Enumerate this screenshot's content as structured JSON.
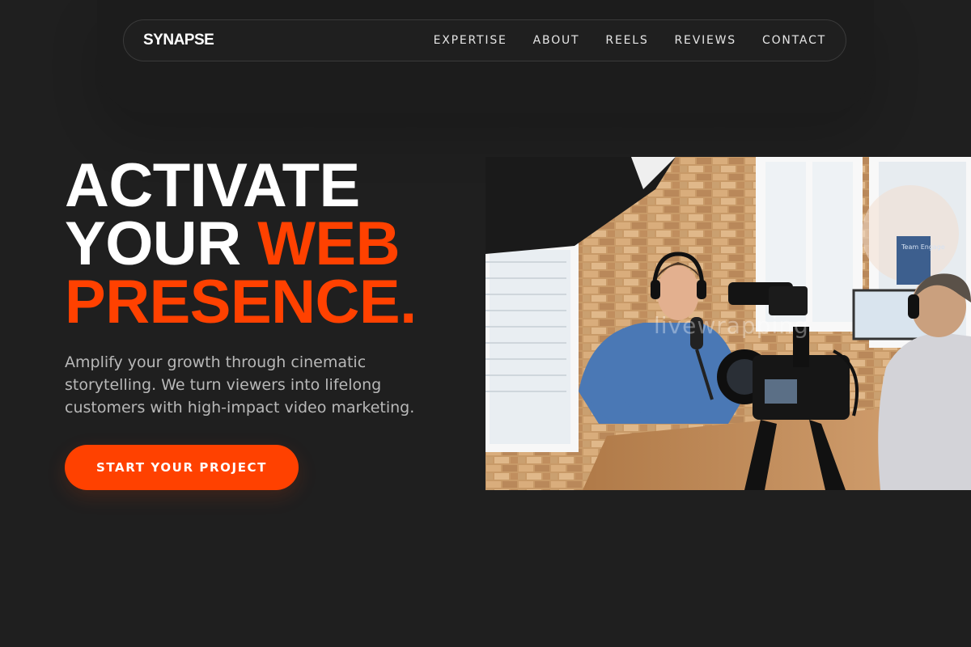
{
  "nav": {
    "logo": "SYNAPSE",
    "links": [
      "EXPERTISE",
      "ABOUT",
      "REELS",
      "REVIEWS",
      "CONTACT"
    ]
  },
  "hero": {
    "headline_line1": "ACTIVATE",
    "headline_line2_white": "YOUR",
    "headline_line2_accent": "WEB",
    "headline_line3_accent": "PRESENCE.",
    "subtitle": "Amplify your growth through cinematic storytelling. We turn viewers into lifelong customers with high-impact video marketing.",
    "cta_label": "START YOUR PROJECT",
    "image_watermark": "livewrapping",
    "image_sign_text": "Team Engage"
  },
  "colors": {
    "background": "#1f1f1f",
    "accent": "#ff4100",
    "text": "#ffffff",
    "muted_text": "#b8b8b8"
  }
}
